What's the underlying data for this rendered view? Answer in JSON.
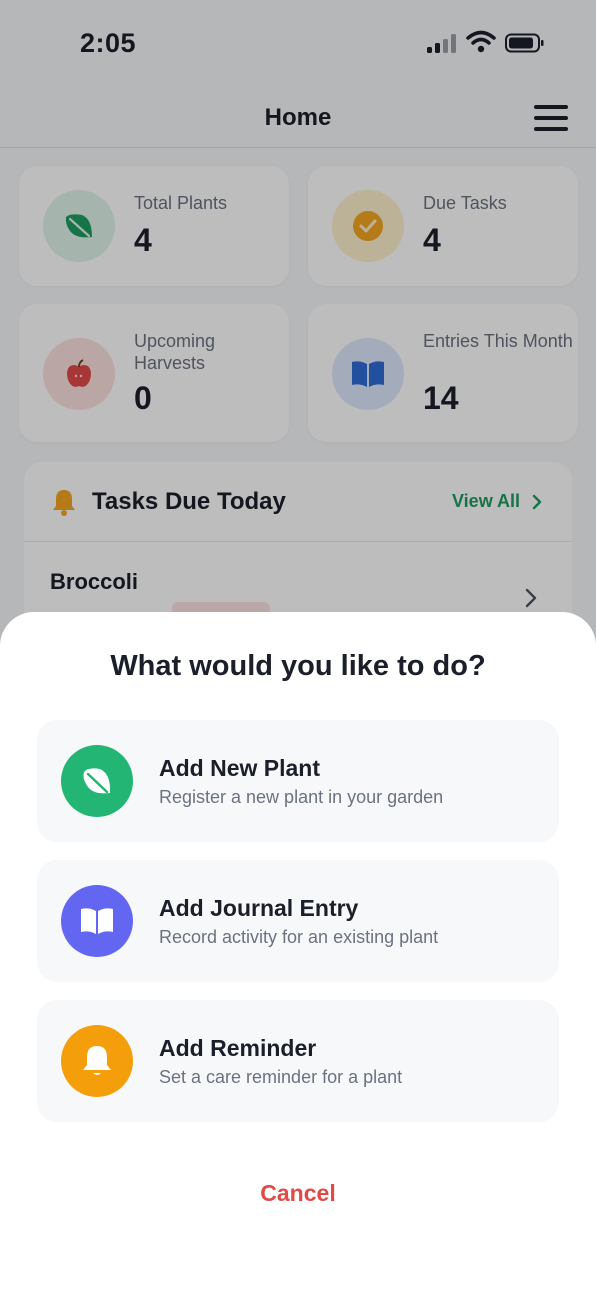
{
  "status_bar": {
    "time": "2:05"
  },
  "header": {
    "title": "Home"
  },
  "stats": [
    {
      "label": "Total Plants",
      "value": "4",
      "icon": "leaf-icon",
      "color": "#1f9d63"
    },
    {
      "label": "Due Tasks",
      "value": "4",
      "icon": "check-circle-icon",
      "color": "#f5a623"
    },
    {
      "label": "Upcoming Harvests",
      "value": "0",
      "icon": "apple-icon",
      "color": "#e24a4a"
    },
    {
      "label": "Entries This Month",
      "value": "14",
      "icon": "book-icon",
      "color": "#2e6bd6"
    }
  ],
  "tasks": {
    "title": "Tasks Due Today",
    "view_all": "View All",
    "items": [
      {
        "name": "Broccoli"
      }
    ]
  },
  "sheet": {
    "title": "What would you like to do?",
    "options": [
      {
        "title": "Add New Plant",
        "subtitle": "Register a new plant in your garden",
        "icon": "leaf-icon",
        "color": "#22b573"
      },
      {
        "title": "Add Journal Entry",
        "subtitle": "Record activity for an existing plant",
        "icon": "book-icon",
        "color": "#6366f1"
      },
      {
        "title": "Add Reminder",
        "subtitle": "Set a care reminder for a plant",
        "icon": "bell-icon",
        "color": "#f59e0b"
      }
    ],
    "cancel": "Cancel"
  }
}
